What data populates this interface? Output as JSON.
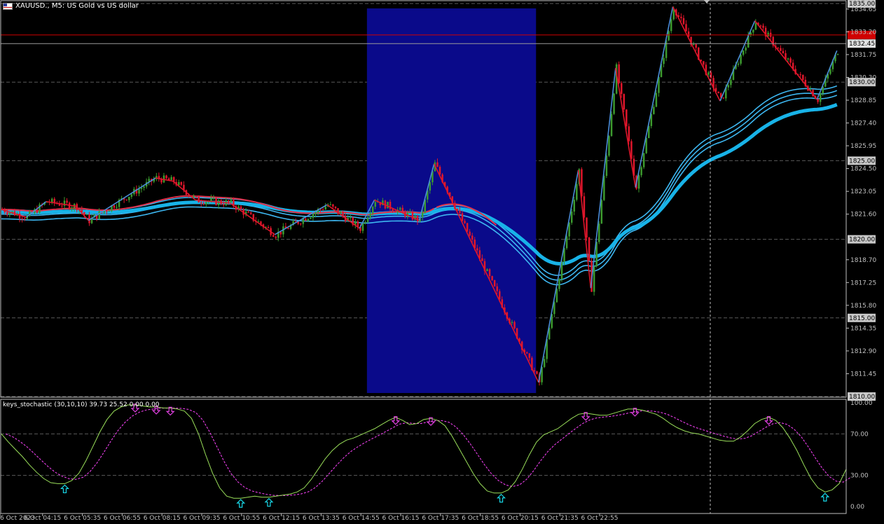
{
  "header": {
    "symbol": "XAUUSD.",
    "timeframe": "M5",
    "description": "US Gold vs US dollar",
    "title_text": "XAUUSD., M5:  US Gold vs US dollar"
  },
  "indicator": {
    "label": "keys_stochastic (30,10,10) 39.73 25.52 0.00 0.00"
  },
  "colors": {
    "background": "#000000",
    "bull_candle": "#3c9a2e",
    "bear_candle": "#e0162b",
    "zigzag_up": "#4a8ed8",
    "zigzag_down": "#e0162b",
    "ma_thick": "#18b3e8",
    "ma_red": "#e0304a",
    "ma_bands": "#3db6f0",
    "session_box": "#0a0a8a",
    "price_line_red": "#d00000",
    "stoch_main": "#9adf5a",
    "stoch_signal": "#ff44ff",
    "arrow_up": "#18d8e8",
    "arrow_down": "#e040e0"
  },
  "chart_data": {
    "type": "candlestick",
    "title": "XAUUSD., M5:  US Gold vs US dollar",
    "price_axis": {
      "ylim": [
        1810.0,
        1835.0
      ],
      "tick_labels": [
        "1834.65",
        "1833.20",
        "1831.75",
        "1830.30",
        "1828.85",
        "1827.40",
        "1825.95",
        "1824.50",
        "1823.05",
        "1821.60",
        "1818.70",
        "1817.25",
        "1815.80",
        "1814.35",
        "1812.90",
        "1811.45"
      ],
      "highlighted_levels": [
        "1835.00",
        "1830.00",
        "1825.00",
        "1820.00",
        "1815.00",
        "1810.00"
      ]
    },
    "current_price_red": "1833.00",
    "current_price_label": "1832.45",
    "time_axis": [
      "6 Oct 2023",
      "6 Oct 04:15",
      "6 Oct 05:35",
      "6 Oct 06:55",
      "6 Oct 08:15",
      "6 Oct 09:35",
      "6 Oct 10:55",
      "6 Oct 12:15",
      "6 Oct 13:35",
      "6 Oct 14:55",
      "6 Oct 16:15",
      "6 Oct 17:35",
      "6 Oct 18:55",
      "6 Oct 20:15",
      "6 Oct 21:35",
      "6 Oct 22:55"
    ],
    "zigzag": [
      [
        0,
        1821.9
      ],
      [
        10,
        1821.4
      ],
      [
        18,
        1822.4
      ],
      [
        30,
        1822.1
      ],
      [
        35,
        1821.2
      ],
      [
        62,
        1823.9
      ],
      [
        69,
        1823.7
      ],
      [
        78,
        1822.5
      ],
      [
        92,
        1822.3
      ],
      [
        110,
        1820.3
      ],
      [
        131,
        1822.2
      ],
      [
        144,
        1820.7
      ],
      [
        150,
        1822.5
      ],
      [
        168,
        1821.2
      ],
      [
        174,
        1824.8
      ],
      [
        216,
        1810.9
      ],
      [
        232,
        1824.4
      ],
      [
        237,
        1816.9
      ],
      [
        247,
        1830.9
      ],
      [
        255,
        1823.3
      ],
      [
        270,
        1834.8
      ],
      [
        289,
        1828.8
      ],
      [
        303,
        1833.9
      ],
      [
        328,
        1828.9
      ],
      [
        336,
        1832.0
      ]
    ],
    "session_highlight": {
      "start_time": "6 Oct 14:55",
      "end_time": "6 Oct 20:15"
    },
    "oscillator": {
      "name": "keys_stochastic",
      "params": [
        30,
        10,
        10
      ],
      "values": [
        39.73,
        25.52,
        0.0,
        0.0
      ],
      "levels": [
        100,
        70,
        30,
        0
      ],
      "tick_labels": [
        "100.00",
        "70.00",
        "30.00",
        "0.00"
      ],
      "main": [
        70,
        62,
        55,
        48,
        40,
        33,
        27,
        23,
        22,
        22,
        25,
        32,
        44,
        58,
        72,
        84,
        92,
        96,
        98,
        98,
        97,
        96,
        96,
        95,
        95,
        94,
        92,
        85,
        70,
        50,
        32,
        18,
        10,
        8,
        8,
        9,
        10,
        9,
        9,
        10,
        11,
        12,
        14,
        18,
        26,
        36,
        46,
        54,
        60,
        64,
        66,
        69,
        72,
        75,
        79,
        83,
        86,
        83,
        79,
        80,
        84,
        85,
        83,
        78,
        68,
        56,
        44,
        32,
        22,
        15,
        13,
        13,
        16,
        24,
        36,
        50,
        62,
        69,
        72,
        75,
        80,
        85,
        89,
        90,
        89,
        88,
        88,
        90,
        92,
        94,
        94,
        93,
        91,
        89,
        85,
        80,
        76,
        73,
        71,
        70,
        68,
        66,
        64,
        63,
        63,
        67,
        73,
        80,
        84,
        86,
        83,
        76,
        66,
        54,
        40,
        27,
        18,
        14,
        16,
        22,
        36
      ]
    }
  }
}
